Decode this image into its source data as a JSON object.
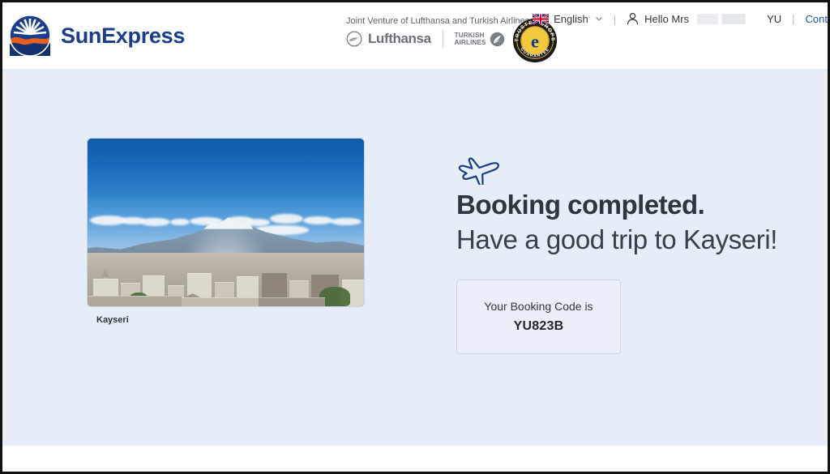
{
  "header": {
    "brand_name": "SunExpress",
    "brand_logo_icon": "sunexpress-sun-logo",
    "joint_venture_text": "Joint Venture of Lufthansa and Turkish Airlines",
    "partners": [
      {
        "name": "Lufthansa",
        "icon": "lufthansa-crane-icon"
      },
      {
        "name_line1": "TURKISH",
        "name_line2": "AIRLINES",
        "icon": "turkish-airlines-bird-icon"
      }
    ],
    "trust_badge": {
      "icon": "trusted-shops-badge",
      "top_text": "TRUSTED SHOPS",
      "bottom_text": "GUARANTEE",
      "center_letter": "e"
    },
    "language": {
      "label": "English",
      "flag_icon": "uk-flag-icon",
      "chevron_icon": "chevron-down-icon"
    },
    "user": {
      "icon": "person-icon",
      "greeting": "Hello Mrs",
      "name_redacted": true,
      "initials": "YU"
    },
    "separator": "|",
    "contact_link": "Cont"
  },
  "main": {
    "destination_photo": {
      "caption": "Kayseri",
      "alt": "Kayseri cityscape with Mount Erciyes"
    },
    "plane_icon": "airplane-icon",
    "headline_line1": "Booking completed.",
    "headline_line2": "Have a good trip to Kayseri!",
    "booking": {
      "label": "Your Booking Code is",
      "code": "YU823B"
    }
  },
  "colors": {
    "brand_navy": "#1b3d8c",
    "brand_orange": "#e8601c",
    "page_background": "#e7edf8",
    "header_background": "#ffffff",
    "link_blue": "#1b58ac",
    "text_dark": "#2f353c"
  }
}
